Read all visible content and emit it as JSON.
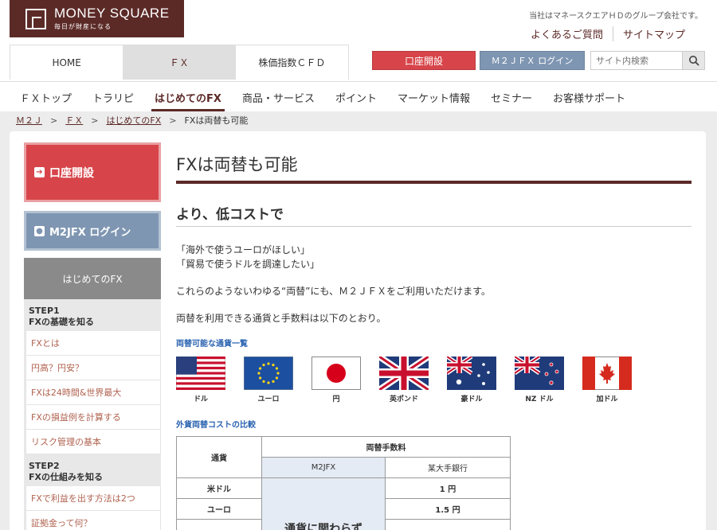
{
  "brand": {
    "name": "MONEY SQUARE",
    "tagline": "毎日が財産になる"
  },
  "header": {
    "group_text": "当社はマネースクエアＨＤのグループ会社です。",
    "faq_link": "よくあるご質問",
    "sitemap_link": "サイトマップ"
  },
  "main_nav": {
    "tabs": [
      {
        "label": "HOME"
      },
      {
        "label": "ＦＸ"
      },
      {
        "label": "株価指数ＣＦＤ"
      }
    ],
    "account_button": "口座開設",
    "login_button": "Ｍ２ＪＦＸ ログイン",
    "search_placeholder": "サイト内検索"
  },
  "sub_nav": {
    "items": [
      {
        "label": "ＦＸトップ"
      },
      {
        "label": "トラリピ"
      },
      {
        "label": "はじめてのFX"
      },
      {
        "label": "商品・サービス"
      },
      {
        "label": "ポイント"
      },
      {
        "label": "マーケット情報"
      },
      {
        "label": "セミナー"
      },
      {
        "label": "お客様サポート"
      }
    ]
  },
  "breadcrumb": {
    "items": [
      "Ｍ２Ｊ",
      "ＦＸ",
      "はじめてのFX"
    ],
    "separator": ">",
    "current": "FXは両替も可能"
  },
  "sidebar": {
    "account_button": "口座開設",
    "login_button": "M2JFX ログイン",
    "section_title": "はじめてのFX",
    "step1": {
      "title": "STEP1",
      "subtitle": "FXの基礎を知る",
      "links": [
        "FXとは",
        "円高？円安？",
        "FXは24時間&世界最大",
        "FXの損益例を計算する",
        "リスク管理の基本"
      ]
    },
    "step2": {
      "title": "STEP2",
      "subtitle": "FXの仕組みを知る",
      "links": [
        "FXで利益を出す方法は2つ",
        "証拠金って何？"
      ]
    }
  },
  "content": {
    "title": "FXは両替も可能",
    "subtitle": "より、低コストで",
    "quote1": "「海外で使うユーロがほしい」",
    "quote2": "「貿易で使うドルを調達したい」",
    "para1": "これらのようないわゆる“両替”にも、Ｍ２ＪＦＸをご利用いただけます。",
    "para2": "両替を利用できる通貨と手数料は以下のとおり。",
    "currencies_label": "両替可能な通貨一覧",
    "currencies": [
      {
        "name": "ドル",
        "flag": "us-flag-icon"
      },
      {
        "name": "ユーロ",
        "flag": "eu-flag-icon"
      },
      {
        "name": "円",
        "flag": "jp-flag-icon"
      },
      {
        "name": "英ポンド",
        "flag": "uk-flag-icon"
      },
      {
        "name": "豪ドル",
        "flag": "au-flag-icon"
      },
      {
        "name": "NZ ドル",
        "flag": "nz-flag-icon"
      },
      {
        "name": "加ドル",
        "flag": "ca-flag-icon"
      }
    ],
    "cost_label": "外貨両替コストの比較",
    "table": {
      "col_currency": "通貨",
      "col_fee": "両替手数料",
      "col_m2jfx": "M2JFX",
      "col_bank": "某大手銀行",
      "rows": [
        {
          "currency": "米ドル",
          "bank": "1 円"
        },
        {
          "currency": "ユーロ",
          "bank": "1.5 円"
        }
      ],
      "m2jfx_note": "通貨に関わらず"
    }
  },
  "colors": {
    "brand": "#5b2a27",
    "accent_red": "#d7454a",
    "accent_blue": "#7f96b2",
    "link_blue": "#2a63b0"
  }
}
